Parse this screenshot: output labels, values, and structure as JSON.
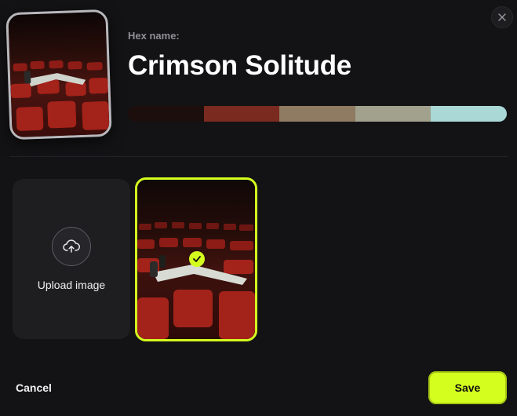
{
  "dialog": {
    "close_icon": "close-icon",
    "hex_label": "Hex name:",
    "title": "Crimson Solitude",
    "palette": [
      "#1c0e0d",
      "#7a2a1f",
      "#8e7b62",
      "#a2a18d",
      "#a9d8d6"
    ]
  },
  "gallery": {
    "upload_label": "Upload image",
    "upload_icon": "cloud-upload-icon",
    "selected_icon": "check-icon"
  },
  "footer": {
    "cancel_label": "Cancel",
    "save_label": "Save"
  },
  "colors": {
    "accent": "#d4ff1e",
    "background": "#131315",
    "tile": "#1e1e21"
  }
}
